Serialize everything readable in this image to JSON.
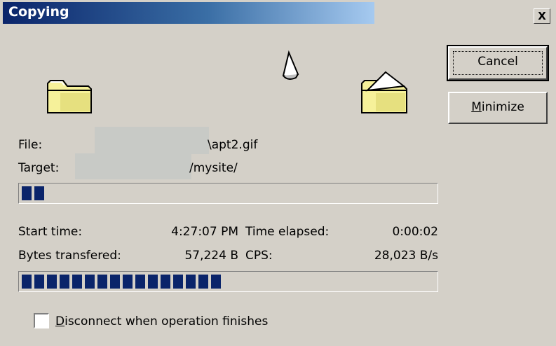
{
  "window": {
    "title": "Copying",
    "close_glyph": "X"
  },
  "buttons": {
    "cancel": "Cancel",
    "minimize_mnemonic": "M",
    "minimize_rest": "inimize"
  },
  "icons": {
    "source": "folder-icon",
    "document": "flying-document-icon",
    "destination": "open-folder-icon"
  },
  "file": {
    "label": "File:",
    "value_suffix": "\\apt2.gif"
  },
  "target": {
    "label": "Target:",
    "value_suffix": "/mysite/"
  },
  "stats": {
    "start_time_label": "Start time:",
    "start_time_value": "4:27:07 PM",
    "elapsed_label": "Time elapsed:",
    "elapsed_value": "0:00:02",
    "bytes_label": "Bytes transfered:",
    "bytes_value": "57,224 B",
    "cps_label": "CPS:",
    "cps_value": "28,023 B/s"
  },
  "progress": {
    "file_fraction": 0.06,
    "total_fraction": 0.5
  },
  "options": {
    "disconnect_mnemonic": "D",
    "disconnect_rest": "isconnect when operation finishes",
    "disconnect_checked": false
  },
  "colors": {
    "title_gradient_start": "#0a246a",
    "title_gradient_end": "#a6caf0",
    "progress_fill": "#0a246a",
    "dialog_face": "#d4d0c8"
  }
}
